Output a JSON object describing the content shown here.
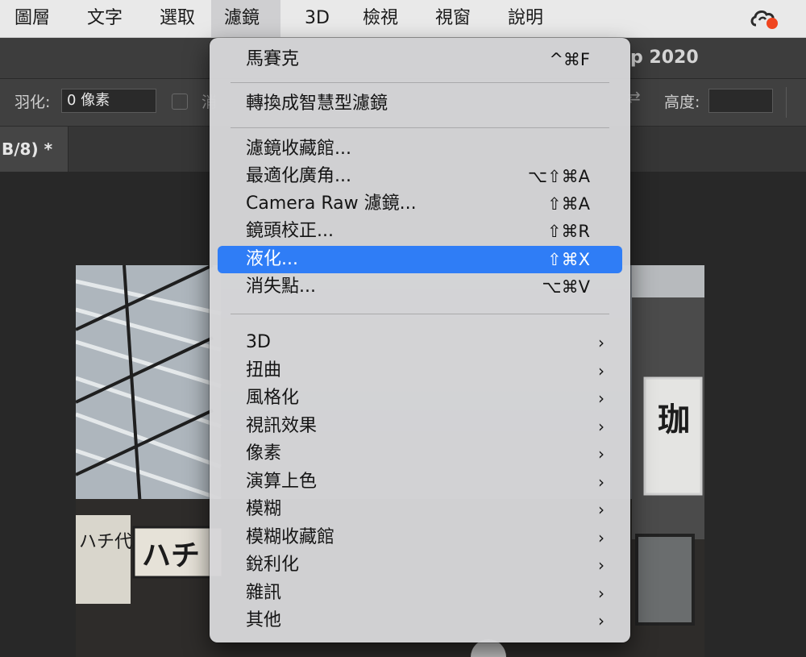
{
  "menubar": {
    "items": [
      {
        "label": "圖層"
      },
      {
        "label": "文字"
      },
      {
        "label": "選取"
      },
      {
        "label": "濾鏡"
      },
      {
        "label": "3D"
      },
      {
        "label": "檢視"
      },
      {
        "label": "視窗"
      },
      {
        "label": "說明"
      }
    ],
    "active_index": 3,
    "cc_icon": "creative-cloud-icon",
    "cc_badge_color": "#f0451f"
  },
  "titlebar": {
    "app_title": "p 2020"
  },
  "options_bar": {
    "feather_label": "羽化:",
    "feather_value": "0 像素",
    "cut_text": "消",
    "height_label": "高度:",
    "height_value": ""
  },
  "tab": {
    "label": "B/8) *"
  },
  "filter_menu": {
    "items": [
      {
        "label": "馬賽克",
        "shortcut": "^⌘F"
      },
      {
        "label": "轉換成智慧型濾鏡",
        "shortcut": ""
      },
      {
        "label": "濾鏡收藏館...",
        "shortcut": ""
      },
      {
        "label": "最適化廣角...",
        "shortcut": "⌥⇧⌘A"
      },
      {
        "label": "Camera Raw 濾鏡...",
        "shortcut": "⇧⌘A"
      },
      {
        "label": "鏡頭校正...",
        "shortcut": "⇧⌘R"
      },
      {
        "label": "液化...",
        "shortcut": "⇧⌘X"
      },
      {
        "label": "消失點...",
        "shortcut": "⌥⌘V"
      },
      {
        "label": "3D",
        "submenu": true
      },
      {
        "label": "扭曲",
        "submenu": true
      },
      {
        "label": "風格化",
        "submenu": true
      },
      {
        "label": "視訊效果",
        "submenu": true
      },
      {
        "label": "像素",
        "submenu": true
      },
      {
        "label": "演算上色",
        "submenu": true
      },
      {
        "label": "模糊",
        "submenu": true
      },
      {
        "label": "模糊收藏館",
        "submenu": true
      },
      {
        "label": "銳利化",
        "submenu": true
      },
      {
        "label": "雜訊",
        "submenu": true
      },
      {
        "label": "其他",
        "submenu": true
      }
    ],
    "highlighted_index": 6,
    "highlight_color": "#2f7df6",
    "submenu_arrow": "›"
  },
  "photo": {
    "sign_right": "珈",
    "sign_left": "ハチ",
    "sign_left_vertical": "ハチ代"
  }
}
